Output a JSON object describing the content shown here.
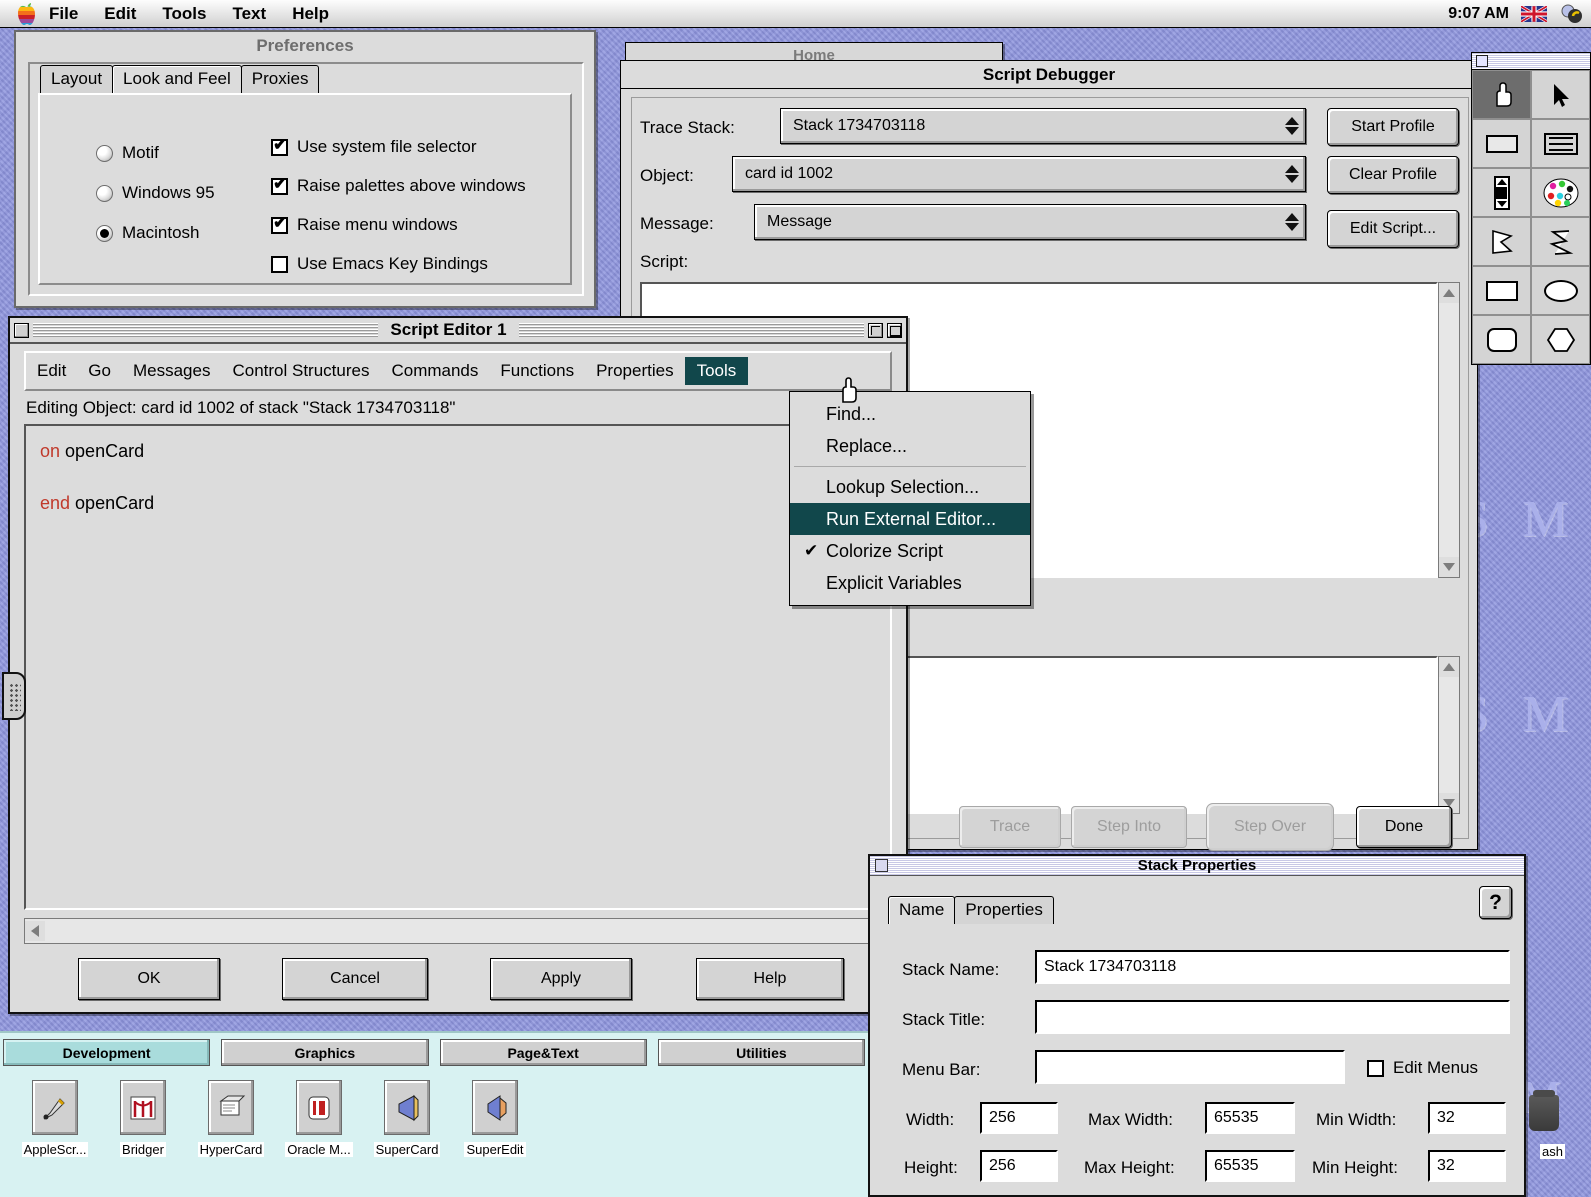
{
  "menubar": {
    "apple_icon": "apple-logo-icon",
    "items": [
      "File",
      "Edit",
      "Tools",
      "Text",
      "Help"
    ],
    "clock": "9:07 AM",
    "flag_icon": "union-jack-flag-icon",
    "extra_icon": "menu-extra-icon"
  },
  "desktop": {
    "watermark": [
      "S",
      "M",
      "S",
      "M",
      "S",
      "M"
    ],
    "trash_label": "ash",
    "bg_color": "#8d94de"
  },
  "hidden_window": {
    "title": "Home"
  },
  "preferences": {
    "title": "Preferences",
    "tabs": [
      {
        "label": "Layout",
        "active": false
      },
      {
        "label": "Look and Feel",
        "active": true
      },
      {
        "label": "Proxies",
        "active": false
      }
    ],
    "radios": [
      {
        "label": "Motif",
        "checked": false
      },
      {
        "label": "Windows 95",
        "checked": false
      },
      {
        "label": "Macintosh",
        "checked": true
      }
    ],
    "checkboxes": [
      {
        "label": "Use system file selector",
        "checked": true
      },
      {
        "label": "Raise palettes above windows",
        "checked": true
      },
      {
        "label": "Raise menu windows",
        "checked": true
      },
      {
        "label": "Use Emacs Key Bindings",
        "checked": false
      }
    ]
  },
  "debugger": {
    "title": "Script Debugger",
    "fields": [
      {
        "label": "Trace Stack:",
        "value": "Stack 1734703118"
      },
      {
        "label": "Object:",
        "value": "card id 1002"
      },
      {
        "label": "Message:",
        "value": "Message"
      }
    ],
    "script_label": "Script:",
    "script_value": "",
    "vars_value": "",
    "buttons_right": [
      "Start Profile",
      "Clear Profile",
      "Edit Script..."
    ],
    "buttons_bottom": [
      {
        "label": "Trace",
        "enabled": false
      },
      {
        "label": "Step Into",
        "enabled": false
      },
      {
        "label": "Step Over",
        "enabled": false
      },
      {
        "label": "Done",
        "enabled": true
      }
    ]
  },
  "script_editor": {
    "title": "Script Editor 1",
    "menus": [
      "Edit",
      "Go",
      "Messages",
      "Control Structures",
      "Commands",
      "Functions",
      "Properties",
      "Tools"
    ],
    "active_menu": "Tools",
    "status": "Editing Object: card id 1002 of stack \"Stack 1734703118\"",
    "code_lines": [
      {
        "keyword": "on",
        "rest": " openCard"
      },
      {
        "keyword": "",
        "rest": ""
      },
      {
        "keyword": "end",
        "rest": " openCard"
      }
    ],
    "buttons": [
      "OK",
      "Cancel",
      "Apply",
      "Help"
    ]
  },
  "tools_menu": {
    "items": [
      {
        "label": "Find...",
        "type": "item",
        "selected": false,
        "checked": false
      },
      {
        "label": "Replace...",
        "type": "item",
        "selected": false,
        "checked": false
      },
      {
        "label": "",
        "type": "separator",
        "selected": false,
        "checked": false
      },
      {
        "label": "Lookup Selection...",
        "type": "item",
        "selected": false,
        "checked": false
      },
      {
        "label": "Run External Editor...",
        "type": "item",
        "selected": true,
        "checked": false
      },
      {
        "label": "Colorize Script",
        "type": "item",
        "selected": false,
        "checked": true
      },
      {
        "label": "Explicit Variables",
        "type": "item",
        "selected": false,
        "checked": false
      }
    ],
    "highlight_color": "#11474b"
  },
  "stack_properties": {
    "title": "Stack Properties",
    "help_label": "?",
    "tabs": [
      {
        "label": "Name",
        "active": true
      },
      {
        "label": "Properties",
        "active": false
      }
    ],
    "stack_name_label": "Stack Name:",
    "stack_name_value": "Stack 1734703118",
    "stack_title_label": "Stack Title:",
    "stack_title_value": "",
    "menu_bar_label": "Menu Bar:",
    "menu_bar_value": "",
    "edit_menus_label": "Edit Menus",
    "edit_menus_checked": false,
    "dims": [
      {
        "label": "Width:",
        "value": "256"
      },
      {
        "label": "Max Width:",
        "value": "65535"
      },
      {
        "label": "Min Width:",
        "value": "32"
      },
      {
        "label": "Height:",
        "value": "256"
      },
      {
        "label": "Max Height:",
        "value": "65535"
      },
      {
        "label": "Min Height:",
        "value": "32"
      }
    ]
  },
  "palette": {
    "tools": [
      {
        "name": "hand-tool-icon",
        "glyph": "☞",
        "selected": true
      },
      {
        "name": "arrow-pointer-tool-icon",
        "glyph": "➤",
        "selected": false
      },
      {
        "name": "field-tool-icon",
        "glyph": "▭",
        "selected": false
      },
      {
        "name": "dashed-rect-tool-icon",
        "glyph": "⬚",
        "selected": false
      },
      {
        "name": "scrollbar-tool-icon",
        "glyph": "▮",
        "selected": false
      },
      {
        "name": "color-palette-tool-icon",
        "glyph": "◓",
        "selected": false
      },
      {
        "name": "polygon-tool-icon",
        "glyph": "◤",
        "selected": false
      },
      {
        "name": "freeform-tool-icon",
        "glyph": "∫",
        "selected": false
      },
      {
        "name": "rectangle-tool-icon",
        "glyph": "▭",
        "selected": false
      },
      {
        "name": "oval-tool-icon",
        "glyph": "⬭",
        "selected": false
      },
      {
        "name": "rounded-rect-tool-icon",
        "glyph": "▢",
        "selected": false
      },
      {
        "name": "hexagon-tool-icon",
        "glyph": "⬡",
        "selected": false
      }
    ]
  },
  "dock": {
    "tabs": [
      {
        "label": "Development",
        "active": true
      },
      {
        "label": "Graphics",
        "active": false
      },
      {
        "label": "Page&Text",
        "active": false
      },
      {
        "label": "Utilities",
        "active": false
      }
    ],
    "items": [
      {
        "label": "AppleScr...",
        "icon": "applescript-icon",
        "glyph": "✎"
      },
      {
        "label": "Bridger",
        "icon": "bridger-icon",
        "glyph": "⛩"
      },
      {
        "label": "HyperCard",
        "icon": "hypercard-icon",
        "glyph": "◈"
      },
      {
        "label": "Oracle M...",
        "icon": "oracle-media-icon",
        "glyph": "▣"
      },
      {
        "label": "SuperCard",
        "icon": "supercard-icon",
        "glyph": "◀"
      },
      {
        "label": "SuperEdit",
        "icon": "superedit-icon",
        "glyph": "◤"
      }
    ]
  }
}
